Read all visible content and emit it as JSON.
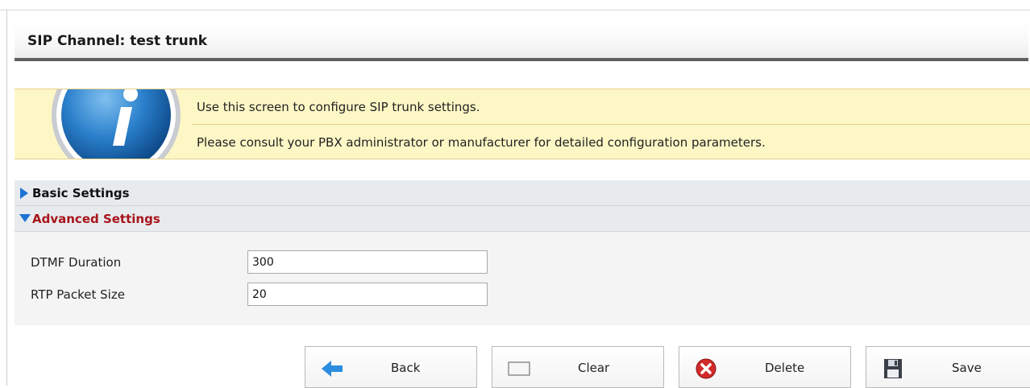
{
  "page": {
    "title": "SIP Channel: test trunk"
  },
  "info": {
    "line1": "Use this screen to configure SIP trunk settings.",
    "line2": "Please consult your PBX administrator or manufacturer for detailed configuration parameters.",
    "icon": "info-icon"
  },
  "sections": {
    "basic": {
      "label": "Basic Settings",
      "state": "collapsed"
    },
    "advanced": {
      "label": "Advanced Settings",
      "state": "expanded"
    }
  },
  "fields": {
    "dtmf_duration": {
      "label": "DTMF Duration",
      "value": "300"
    },
    "rtp_packet_size": {
      "label": "RTP Packet Size",
      "value": "20"
    }
  },
  "buttons": {
    "back": "Back",
    "clear": "Clear",
    "delete": "Delete",
    "save": "Save"
  },
  "colors": {
    "advanced_label": "#a8131a",
    "arrow": "#1e73d6",
    "info_bg": "#fdf7c6"
  }
}
